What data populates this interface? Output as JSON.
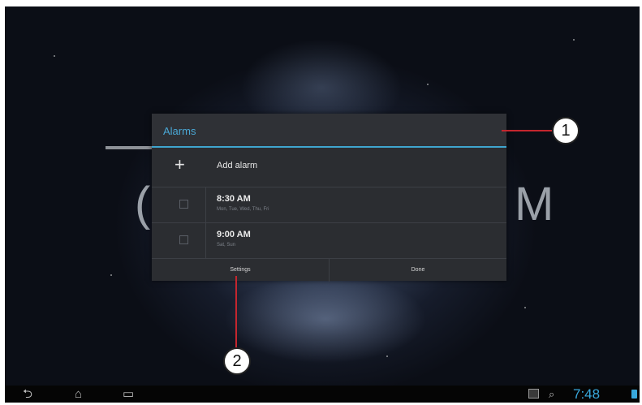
{
  "background": {
    "clock_left_fragment": "(",
    "clock_right_fragment": "M"
  },
  "dialog": {
    "title": "Alarms",
    "add_label": "Add alarm",
    "add_icon": "plus-icon",
    "alarms": [
      {
        "time": "8:30 AM",
        "days": "Mon, Tue, Wed, Thu, Fri",
        "enabled": false
      },
      {
        "time": "9:00 AM",
        "days": "Sat, Sun",
        "enabled": false
      }
    ],
    "settings_label": "Settings",
    "done_label": "Done"
  },
  "callouts": {
    "one": "1",
    "two": "2"
  },
  "status_bar": {
    "time": "7:48"
  },
  "colors": {
    "accent": "#3fa5cf",
    "callout_line": "#c4262e"
  }
}
